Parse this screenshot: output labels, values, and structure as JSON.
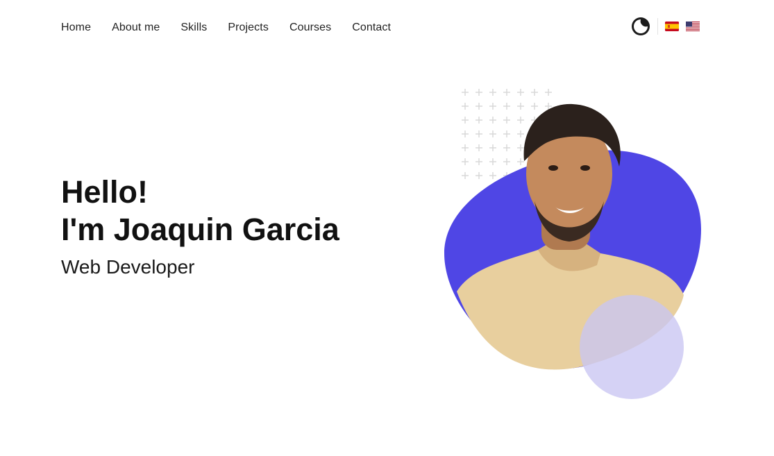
{
  "nav": {
    "items": [
      {
        "label": "Home"
      },
      {
        "label": "About me"
      },
      {
        "label": "Skills"
      },
      {
        "label": "Projects"
      },
      {
        "label": "Courses"
      },
      {
        "label": "Contact"
      }
    ]
  },
  "controls": {
    "theme_icon": "moon-icon",
    "languages": [
      {
        "code": "es",
        "icon": "flag-spain-icon"
      },
      {
        "code": "en",
        "icon": "flag-usa-icon"
      }
    ]
  },
  "hero": {
    "greeting": "Hello!",
    "name_line": "I'm Joaquin Garcia",
    "role": "Web Developer"
  },
  "colors": {
    "accent": "#4F46E5",
    "accent_soft": "#D6D3F5",
    "text": "#111111"
  }
}
